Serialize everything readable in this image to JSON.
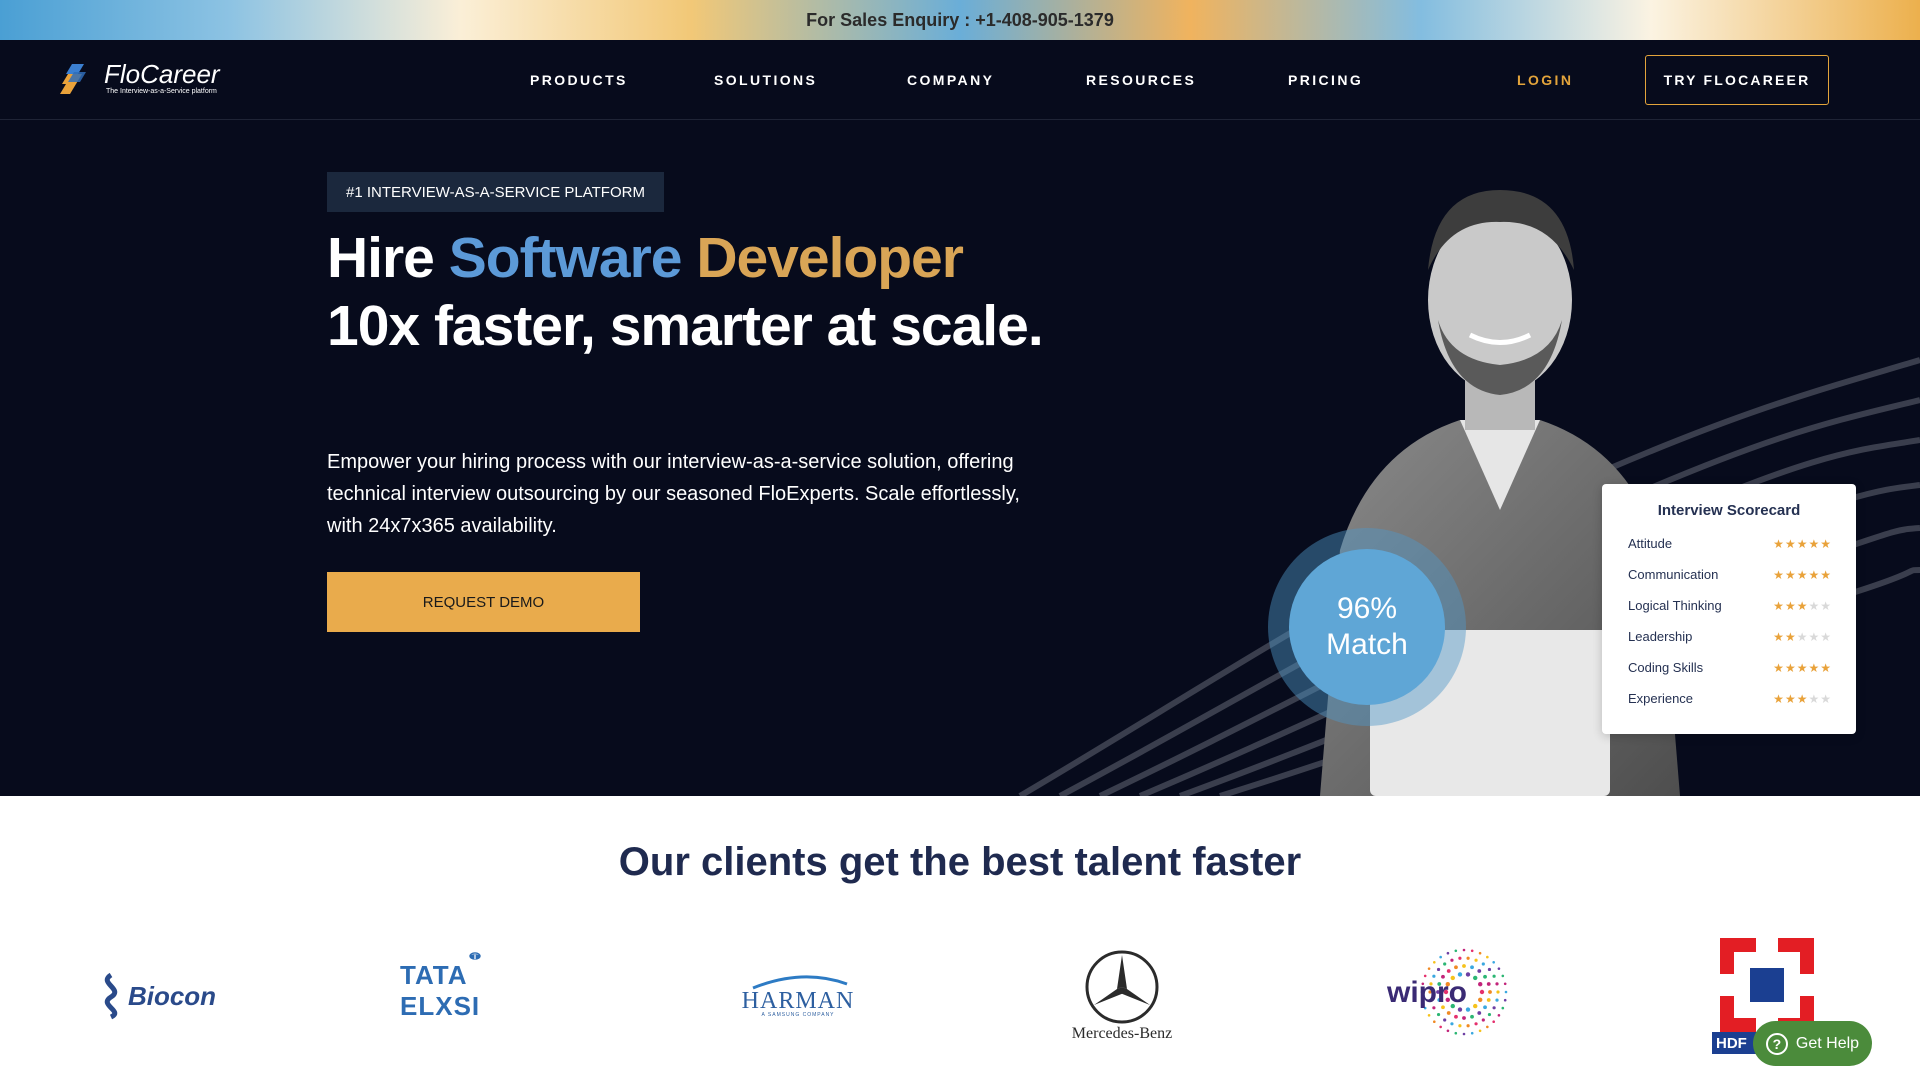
{
  "topbar": {
    "text": "For Sales Enquiry : +1-408-905-1379"
  },
  "header": {
    "logo_text": "FloCareer",
    "logo_tagline": "The Interview-as-a-Service platform",
    "nav": [
      "PRODUCTS",
      "SOLUTIONS",
      "COMPANY",
      "RESOURCES",
      "PRICING"
    ],
    "login": "LOGIN",
    "cta": "TRY FLOCAREER"
  },
  "hero": {
    "badge": "#1 INTERVIEW-AS-A-SERVICE PLATFORM",
    "headline": {
      "part1": "Hire ",
      "blue": "Software",
      "space": " ",
      "gold": "Developer",
      "part2": "10x faster, smarter at scale."
    },
    "description": "Empower your hiring process with our interview-as-a-service solution, offering technical interview outsourcing by our seasoned FloExperts. Scale effortlessly, with 24x7x365 availability.",
    "cta": "REQUEST DEMO",
    "match": {
      "value": "96%",
      "label": "Match"
    },
    "scorecard": {
      "title": "Interview Scorecard",
      "rows": [
        {
          "label": "Attitude",
          "rating": 5
        },
        {
          "label": "Communication",
          "rating": 5
        },
        {
          "label": "Logical Thinking",
          "rating": 3
        },
        {
          "label": "Leadership",
          "rating": 2
        },
        {
          "label": "Coding Skills",
          "rating": 5
        },
        {
          "label": "Experience",
          "rating": 3
        }
      ],
      "max_rating": 5
    }
  },
  "clients": {
    "title": "Our clients get the best talent faster",
    "logos": [
      {
        "name": "Biocon",
        "icon": "biocon-logo"
      },
      {
        "name": "TATA ELXSI",
        "icon": "tata-logo"
      },
      {
        "name": "HARMAN",
        "sub": "A SAMSUNG COMPANY",
        "icon": "harman-logo"
      },
      {
        "name": "Mercedes-Benz",
        "icon": "mercedes-star-logo"
      },
      {
        "name": "wipro",
        "icon": "wipro-logo"
      },
      {
        "name": "HDF",
        "icon": "hdfc-logo"
      }
    ]
  },
  "help": {
    "label": "Get Help",
    "icon": "question-icon"
  },
  "colors": {
    "hero_bg": "#070b1c",
    "accent_gold": "#e9ab4c",
    "headline_blue": "#5c9ad8",
    "headline_gold": "#d9a556",
    "clients_title": "#1f2a4f",
    "help_green": "#4b8b3b"
  }
}
